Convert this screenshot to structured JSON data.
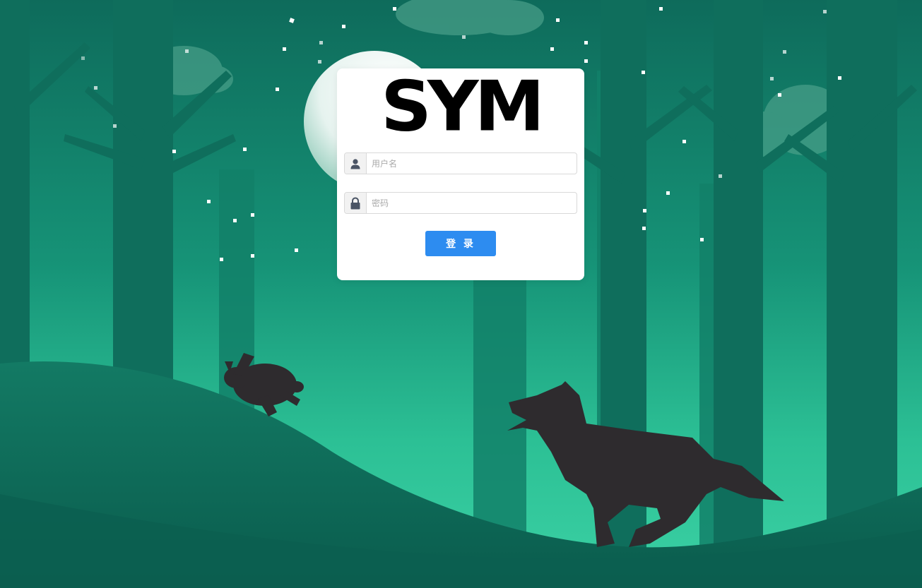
{
  "login": {
    "logo_text": "SYM",
    "username": {
      "icon": "user-icon",
      "placeholder": "用户名",
      "value": ""
    },
    "password": {
      "icon": "lock-icon",
      "placeholder": "密码",
      "value": ""
    },
    "submit_label": "登 录"
  },
  "colors": {
    "card_background": "#ffffff",
    "button_background": "#2d8cf0",
    "button_text": "#ffffff",
    "logo": "#000000",
    "icon": "#4a5465",
    "background_dark": "#0d6a5a",
    "background_light": "#35c99d",
    "silhouette": "#2e2b2e"
  },
  "background": {
    "scene": "forest-night-illustration",
    "elements": [
      "moon",
      "trees",
      "rabbit-silhouette",
      "wolf-silhouette",
      "snowflakes"
    ]
  }
}
